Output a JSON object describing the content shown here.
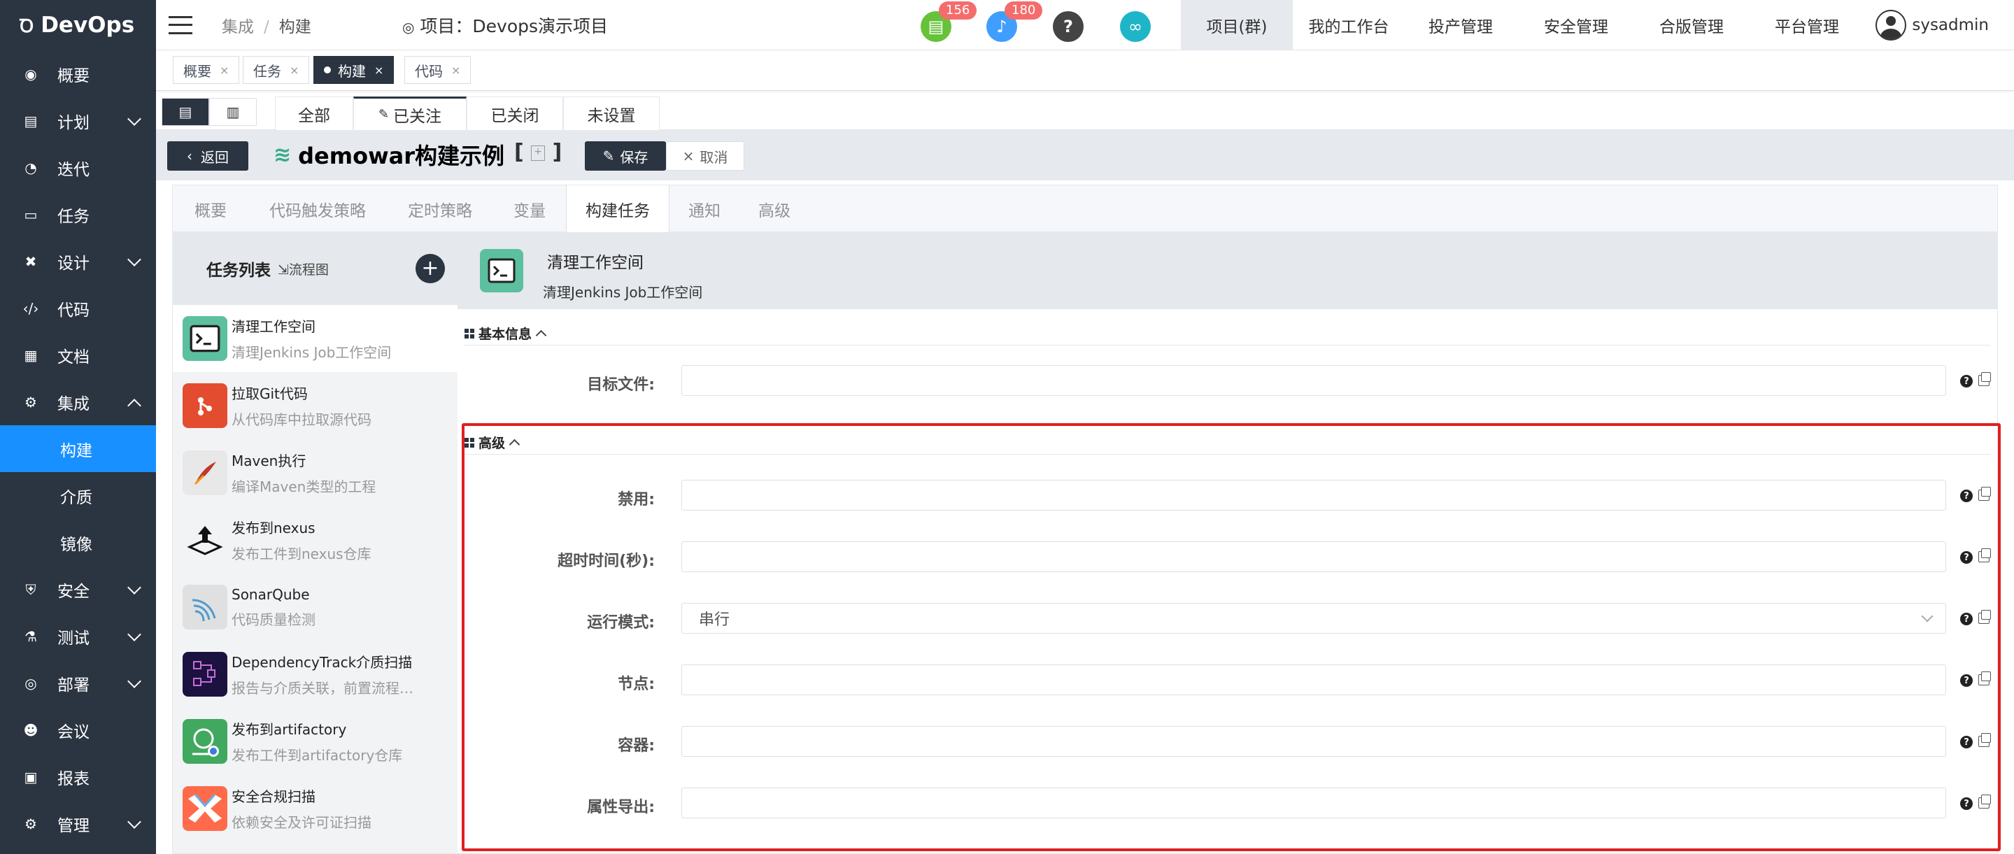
{
  "app": {
    "logo": "DevOps"
  },
  "sidebar": {
    "items": [
      {
        "label": "概要",
        "icon": "dashboard-icon",
        "glyph": "◉"
      },
      {
        "label": "计划",
        "icon": "plan-icon",
        "glyph": "▤",
        "expandable": true
      },
      {
        "label": "迭代",
        "icon": "iteration-icon",
        "glyph": "◔"
      },
      {
        "label": "任务",
        "icon": "task-icon",
        "glyph": "▭"
      },
      {
        "label": "设计",
        "icon": "design-icon",
        "glyph": "✖",
        "expandable": true
      },
      {
        "label": "代码",
        "icon": "code-icon",
        "glyph": "‹/›"
      },
      {
        "label": "文档",
        "icon": "document-icon",
        "glyph": "▦"
      },
      {
        "label": "集成",
        "icon": "integration-icon",
        "glyph": "⚙",
        "expanded": true
      }
    ],
    "sub_items": [
      "构建",
      "介质",
      "镜像"
    ],
    "bottom_items": [
      {
        "label": "安全",
        "icon": "shield-icon",
        "glyph": "⛨",
        "expandable": true
      },
      {
        "label": "测试",
        "icon": "flask-icon",
        "glyph": "⚗",
        "expandable": true
      },
      {
        "label": "部署",
        "icon": "deploy-icon",
        "glyph": "◎",
        "expandable": true
      },
      {
        "label": "会议",
        "icon": "meeting-icon",
        "glyph": "☻"
      },
      {
        "label": "报表",
        "icon": "report-icon",
        "glyph": "▣"
      },
      {
        "label": "管理",
        "icon": "settings-icon",
        "glyph": "⚙",
        "expandable": true
      }
    ]
  },
  "header": {
    "breadcrumb": [
      "集成",
      "构建"
    ],
    "project_label": "项目：Devops演示项目",
    "doc_badge": "156",
    "bell_badge": "180",
    "menus": [
      "项目(群)",
      "我的工作台",
      "投产管理",
      "安全管理",
      "合版管理",
      "平台管理"
    ],
    "user": "sysadmin"
  },
  "tags": [
    "概要",
    "任务",
    "构建",
    "代码"
  ],
  "filter_tabs": [
    "全部",
    "已关注",
    "已关闭",
    "未设置"
  ],
  "titlebar": {
    "back": "返回",
    "title": "demowar构建示例",
    "save": "保存",
    "cancel": "取消"
  },
  "panel_tabs": [
    "概要",
    "代码触发策略",
    "定时策略",
    "变量",
    "构建任务",
    "通知",
    "高级"
  ],
  "task_list": {
    "title": "任务列表",
    "flow_link": "流程图",
    "tasks": [
      {
        "name": "清理工作空间",
        "desc": "清理Jenkins Job工作空间",
        "color": "#5cbf9f"
      },
      {
        "name": "拉取Git代码",
        "desc": "从代码库中拉取源代码",
        "color": "#e44c30"
      },
      {
        "name": "Maven执行",
        "desc": "编译Maven类型的工程",
        "color": "#e8e8e8"
      },
      {
        "name": "发布到nexus",
        "desc": "发布工件到nexus仓库",
        "color": "#f2f3f5"
      },
      {
        "name": "SonarQube",
        "desc": "代码质量检测",
        "color": "#e0e0e0"
      },
      {
        "name": "DependencyTrack介质扫描",
        "desc": "报告与介质关联，前置流程必…",
        "color": "#1c1240"
      },
      {
        "name": "发布到artifactory",
        "desc": "发布工件到artifactory仓库",
        "color": "#41a85f"
      },
      {
        "name": "安全合规扫描",
        "desc": "依赖安全及许可证扫描",
        "color": "#ff6b4a"
      }
    ]
  },
  "detail": {
    "name": "清理工作空间",
    "desc": "清理Jenkins Job工作空间",
    "basic_section": "基本信息",
    "advanced_section": "高级",
    "basic_fields": [
      {
        "label": "目标文件:",
        "value": ""
      }
    ],
    "advanced_fields": [
      {
        "label": "禁用:",
        "value": ""
      },
      {
        "label": "超时时间(秒):",
        "value": ""
      },
      {
        "label": "运行模式:",
        "value": "串行",
        "select": true
      },
      {
        "label": "节点:",
        "value": ""
      },
      {
        "label": "容器:",
        "value": ""
      },
      {
        "label": "属性导出:",
        "value": ""
      }
    ]
  },
  "colors": {
    "sidebar": "#2b3441",
    "accent": "#1890ff",
    "highlight": "#e02020"
  }
}
